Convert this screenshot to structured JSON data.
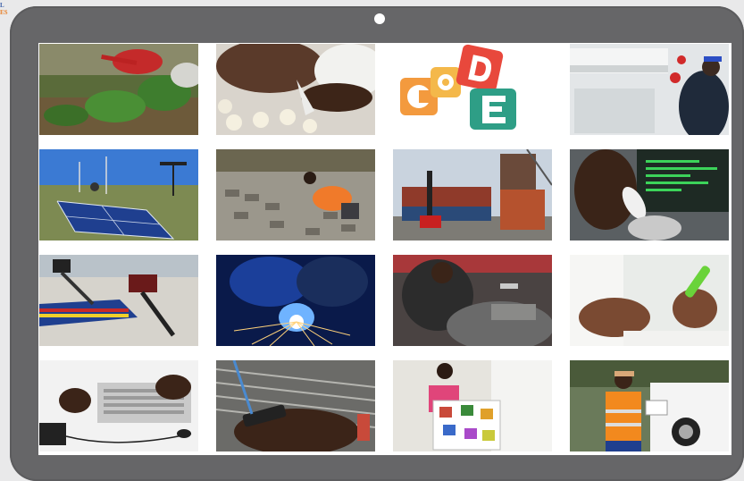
{
  "corner_brand": {
    "line1": "L",
    "line2": "ES"
  },
  "logo": {
    "letters": [
      "C",
      "O",
      "D",
      "E"
    ]
  },
  "photos": [
    {
      "icon": "watering-plants-photo"
    },
    {
      "icon": "piping-pastry-photo"
    },
    {
      "icon": "code-logo"
    },
    {
      "icon": "air-conditioner-repair-photo"
    },
    {
      "icon": "solar-panels-photo"
    },
    {
      "icon": "paving-worker-photo"
    },
    {
      "icon": "shipping-containers-photo"
    },
    {
      "icon": "phone-call-centre-photo"
    },
    {
      "icon": "boat-outboard-motors-photo"
    },
    {
      "icon": "welding-sparks-photo"
    },
    {
      "icon": "car-mechanic-photo"
    },
    {
      "icon": "lab-test-tube-photo"
    },
    {
      "icon": "laptop-typing-photo"
    },
    {
      "icon": "weaving-phone-photo"
    },
    {
      "icon": "teacher-poster-photo"
    },
    {
      "icon": "safety-vest-inspector-photo"
    }
  ]
}
